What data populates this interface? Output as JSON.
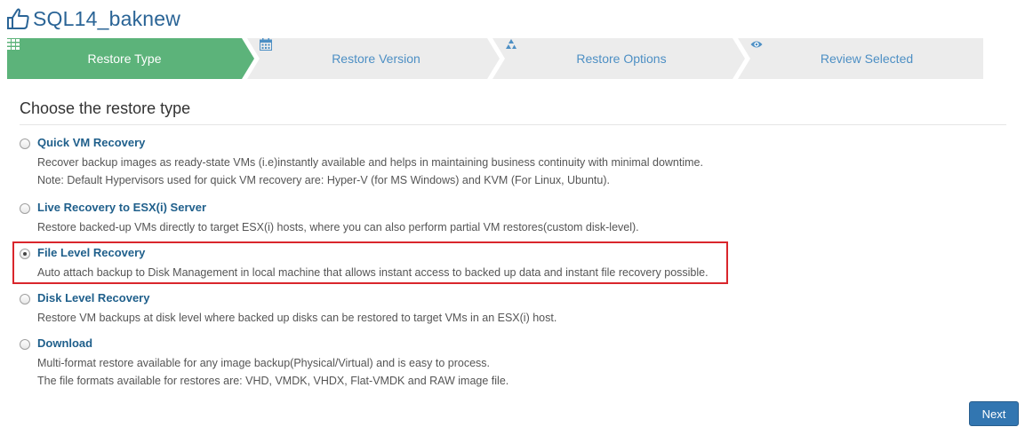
{
  "header": {
    "title": "SQL14_baknew",
    "icon": "thumbs-up-icon"
  },
  "wizard": {
    "steps": [
      {
        "label": "Restore Type",
        "icon": "grid-icon",
        "active": true
      },
      {
        "label": "Restore Version",
        "icon": "calendar-icon",
        "active": false
      },
      {
        "label": "Restore Options",
        "icon": "recycle-icon",
        "active": false
      },
      {
        "label": "Review Selected",
        "icon": "eye-icon",
        "active": false
      }
    ],
    "colors": {
      "active": "#5cb37a",
      "inactive": "#ececec",
      "active_text": "#ffffff",
      "inactive_text": "#4d8fc4"
    }
  },
  "main": {
    "section_title": "Choose the restore type",
    "options": [
      {
        "title": "Quick VM Recovery",
        "desc1": "Recover backup images as ready-state VMs (i.e)instantly available and helps in maintaining business continuity with minimal downtime.",
        "desc2": "Note: Default Hypervisors used for quick VM recovery are: Hyper-V (for MS Windows) and KVM (For Linux, Ubuntu).",
        "selected": false
      },
      {
        "title": "Live Recovery to ESX(i) Server",
        "desc1": "Restore backed-up VMs directly to target ESX(i) hosts, where you can also perform partial VM restores(custom disk-level).",
        "selected": false
      },
      {
        "title": "File Level Recovery",
        "desc1": "Auto attach backup to Disk Management in local machine that allows instant access to backed up data and instant file recovery possible.",
        "selected": true
      },
      {
        "title": "Disk Level Recovery",
        "desc1": "Restore VM backups at disk level where backed up disks can be restored to target VMs in an ESX(i) host.",
        "selected": false
      },
      {
        "title": "Download",
        "desc1": "Multi-format restore available for any image backup(Physical/Virtual) and is easy to process.",
        "desc2": "The file formats available for restores are: VHD, VMDK, VHDX, Flat-VMDK and RAW image file.",
        "selected": false
      }
    ]
  },
  "footer": {
    "next_label": "Next"
  }
}
